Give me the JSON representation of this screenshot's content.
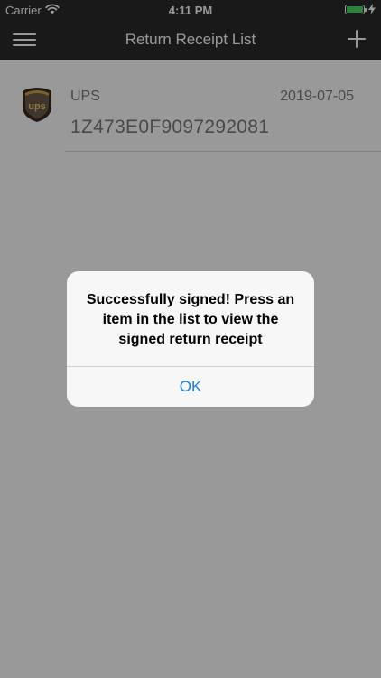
{
  "status_bar": {
    "carrier": "Carrier",
    "time": "4:11 PM"
  },
  "nav": {
    "title": "Return Receipt List"
  },
  "receipts": [
    {
      "carrier": "UPS",
      "date": "2019-07-05",
      "tracking_number": "1Z473E0F9097292081"
    }
  ],
  "alert": {
    "message": "Successfully signed! Press an item in the list to view the signed return receipt",
    "ok_label": "OK"
  },
  "colors": {
    "nav_background": "#2b2b2b",
    "alert_button": "#1a82d6",
    "battery": "#4cd964"
  }
}
